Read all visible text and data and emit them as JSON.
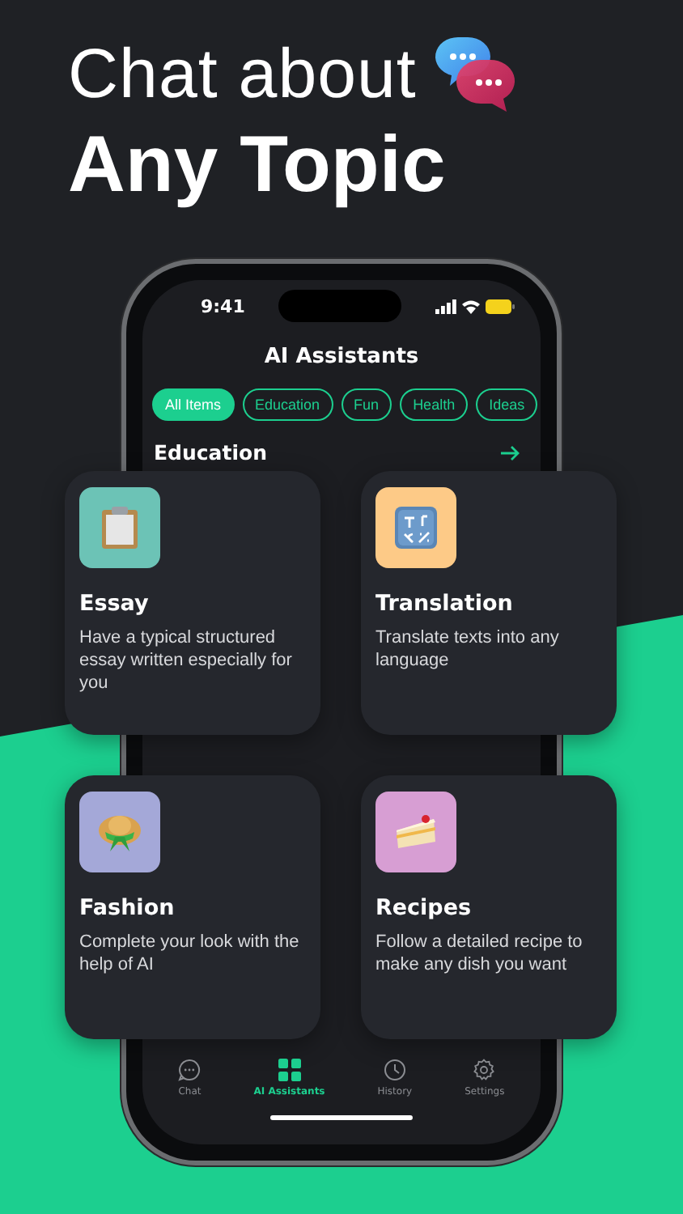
{
  "headline": {
    "line_1": "Chat about",
    "line_2": "Any Topic"
  },
  "status_bar": {
    "time": "9:41"
  },
  "screen_title": "AI Assistants",
  "chips": [
    {
      "label": "All Items",
      "selected": true
    },
    {
      "label": "Education",
      "selected": false
    },
    {
      "label": "Fun",
      "selected": false
    },
    {
      "label": "Health",
      "selected": false
    },
    {
      "label": "Ideas",
      "selected": false
    }
  ],
  "section": {
    "title": "Education"
  },
  "cards": [
    {
      "kind": "clipboard",
      "color": "#6cc3b6",
      "title": "Essay",
      "description": "Have a typical structured essay written especially for you"
    },
    {
      "kind": "symbols",
      "color": "#fdca87",
      "title": "Translation",
      "description": "Translate texts into any language"
    },
    {
      "kind": "hat",
      "color": "#a4a8d8",
      "title": "Fashion",
      "description": "Complete your look with the help of AI"
    },
    {
      "kind": "cake",
      "color": "#d79ed3",
      "title": "Recipes",
      "description": "Follow a detailed recipe to make any dish you want"
    }
  ],
  "tab_bar": [
    {
      "kind": "chat",
      "label": "Chat",
      "selected": false
    },
    {
      "kind": "grid",
      "label": "AI Assistants",
      "selected": true
    },
    {
      "kind": "clock",
      "label": "History",
      "selected": false
    },
    {
      "kind": "gear",
      "label": "Settings",
      "selected": false
    }
  ]
}
